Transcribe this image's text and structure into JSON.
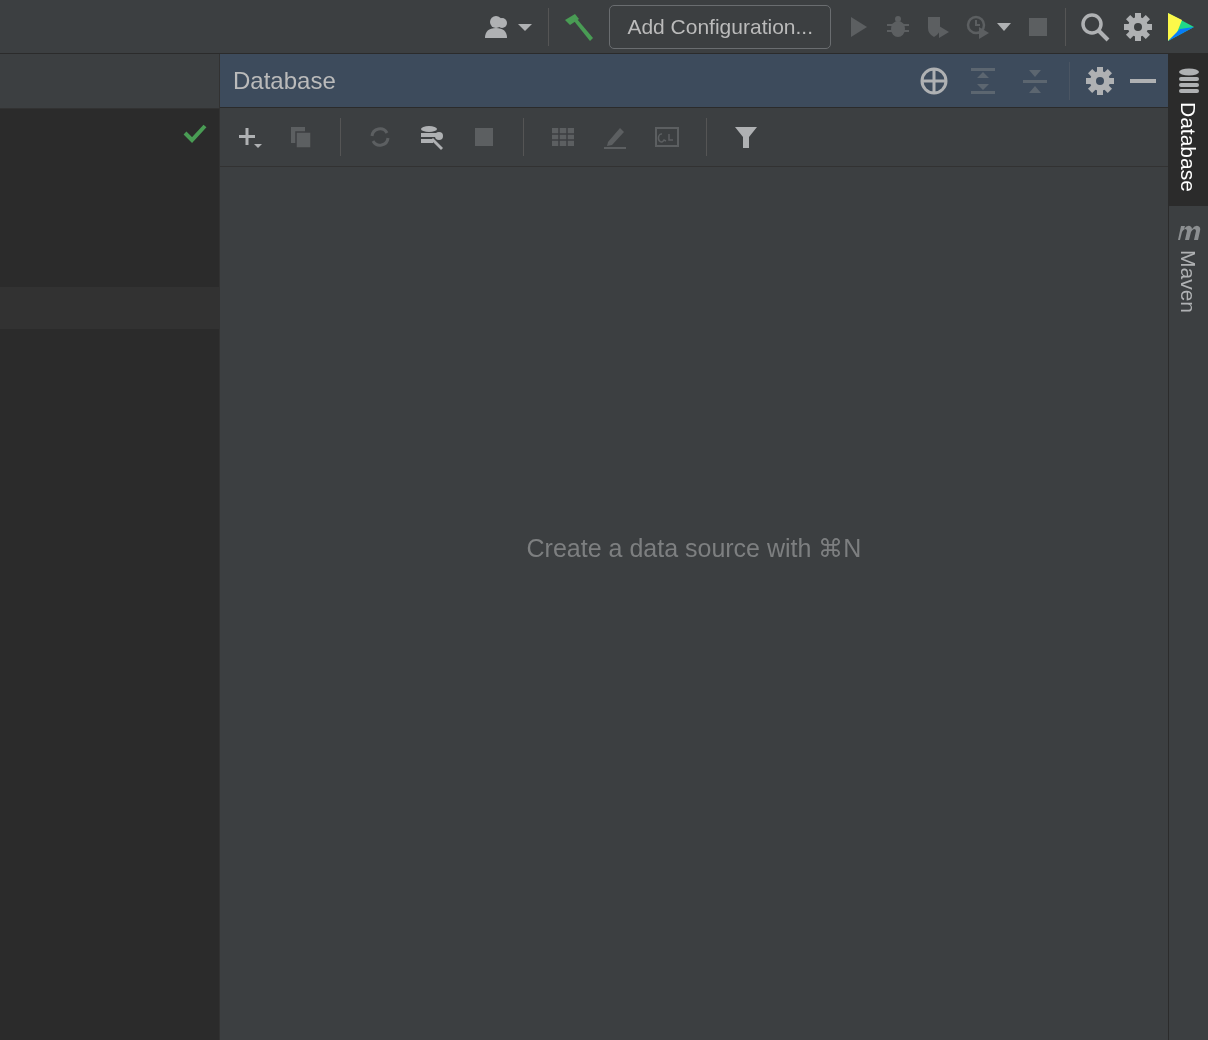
{
  "toolbar": {
    "config_button": "Add Configuration...",
    "actions": [
      {
        "kind": "run",
        "disabled": true
      },
      {
        "kind": "debug",
        "disabled": true
      },
      {
        "kind": "coverage",
        "disabled": true
      },
      {
        "kind": "profile",
        "disabled": true
      },
      {
        "kind": "stop",
        "disabled": true
      }
    ]
  },
  "database_panel": {
    "title": "Database",
    "tools": [
      {
        "kind": "add",
        "disabled": false
      },
      {
        "kind": "duplicate",
        "disabled": true
      },
      {
        "kind": "sep"
      },
      {
        "kind": "refresh",
        "disabled": true
      },
      {
        "kind": "properties",
        "disabled": false
      },
      {
        "kind": "stop",
        "disabled": true
      },
      {
        "kind": "sep"
      },
      {
        "kind": "table",
        "disabled": true
      },
      {
        "kind": "edit",
        "disabled": true
      },
      {
        "kind": "console",
        "disabled": true
      },
      {
        "kind": "sep"
      },
      {
        "kind": "filter",
        "disabled": false
      }
    ],
    "empty_text": "Create a data source with ⌘N"
  },
  "side_tabs": [
    {
      "label": "Database",
      "kind": "database",
      "selected": true
    },
    {
      "label": "Maven",
      "kind": "maven",
      "selected": false
    }
  ]
}
